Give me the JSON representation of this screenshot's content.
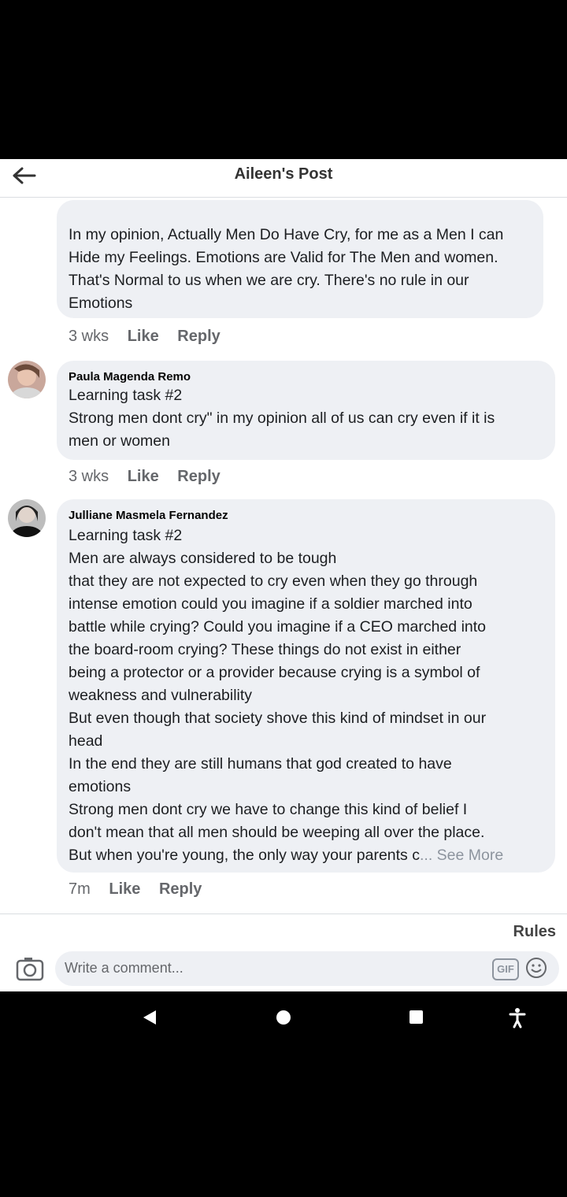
{
  "header": {
    "title": "Aileen's Post"
  },
  "comments": [
    {
      "author": "",
      "text": "In my opinion, Actually Men Do Have Cry, for me as a Men I can\nHide my Feelings. Emotions are Valid for The Men and women.\nThat's Normal to us when we are cry. There's no rule in our\nEmotions",
      "time": "3 wks",
      "like": "Like",
      "reply": "Reply"
    },
    {
      "author": "Paula Magenda Remo",
      "text": "Learning task #2\nStrong men dont cry\" in my opinion all of us can cry even if it is\nmen or women",
      "time": "3 wks",
      "like": "Like",
      "reply": "Reply"
    },
    {
      "author": "Julliane Masmela Fernandez",
      "text": "Learning task #2\nMen are always considered to be tough\nthat  they are not expected to cry even when they go through\nintense emotion could you imagine if a soldier marched into\nbattle while crying? Could you imagine if a CEO marched into\nthe board-room crying? These things do not exist in either\nbeing a protector or a provider because crying is a symbol of\nweakness and vulnerability\nBut even though that society shove this kind of mindset in our\nhead\nIn the end they are still humans that god created to have\nemotions\nStrong men dont cry we have to change this kind of belief  I\ndon't mean that all men should be weeping all over the place.\nBut when you're young, the only way your parents c",
      "see_more": "... See More",
      "time": "7m",
      "like": "Like",
      "reply": "Reply"
    }
  ],
  "footer": {
    "rules": "Rules",
    "comment_placeholder": "Write a comment...",
    "gif_label": "GIF"
  },
  "icons": [
    "back-arrow-icon",
    "camera-icon",
    "gif-icon",
    "emoji-icon",
    "nav-back-icon",
    "nav-home-icon",
    "nav-recents-icon",
    "accessibility-icon"
  ]
}
